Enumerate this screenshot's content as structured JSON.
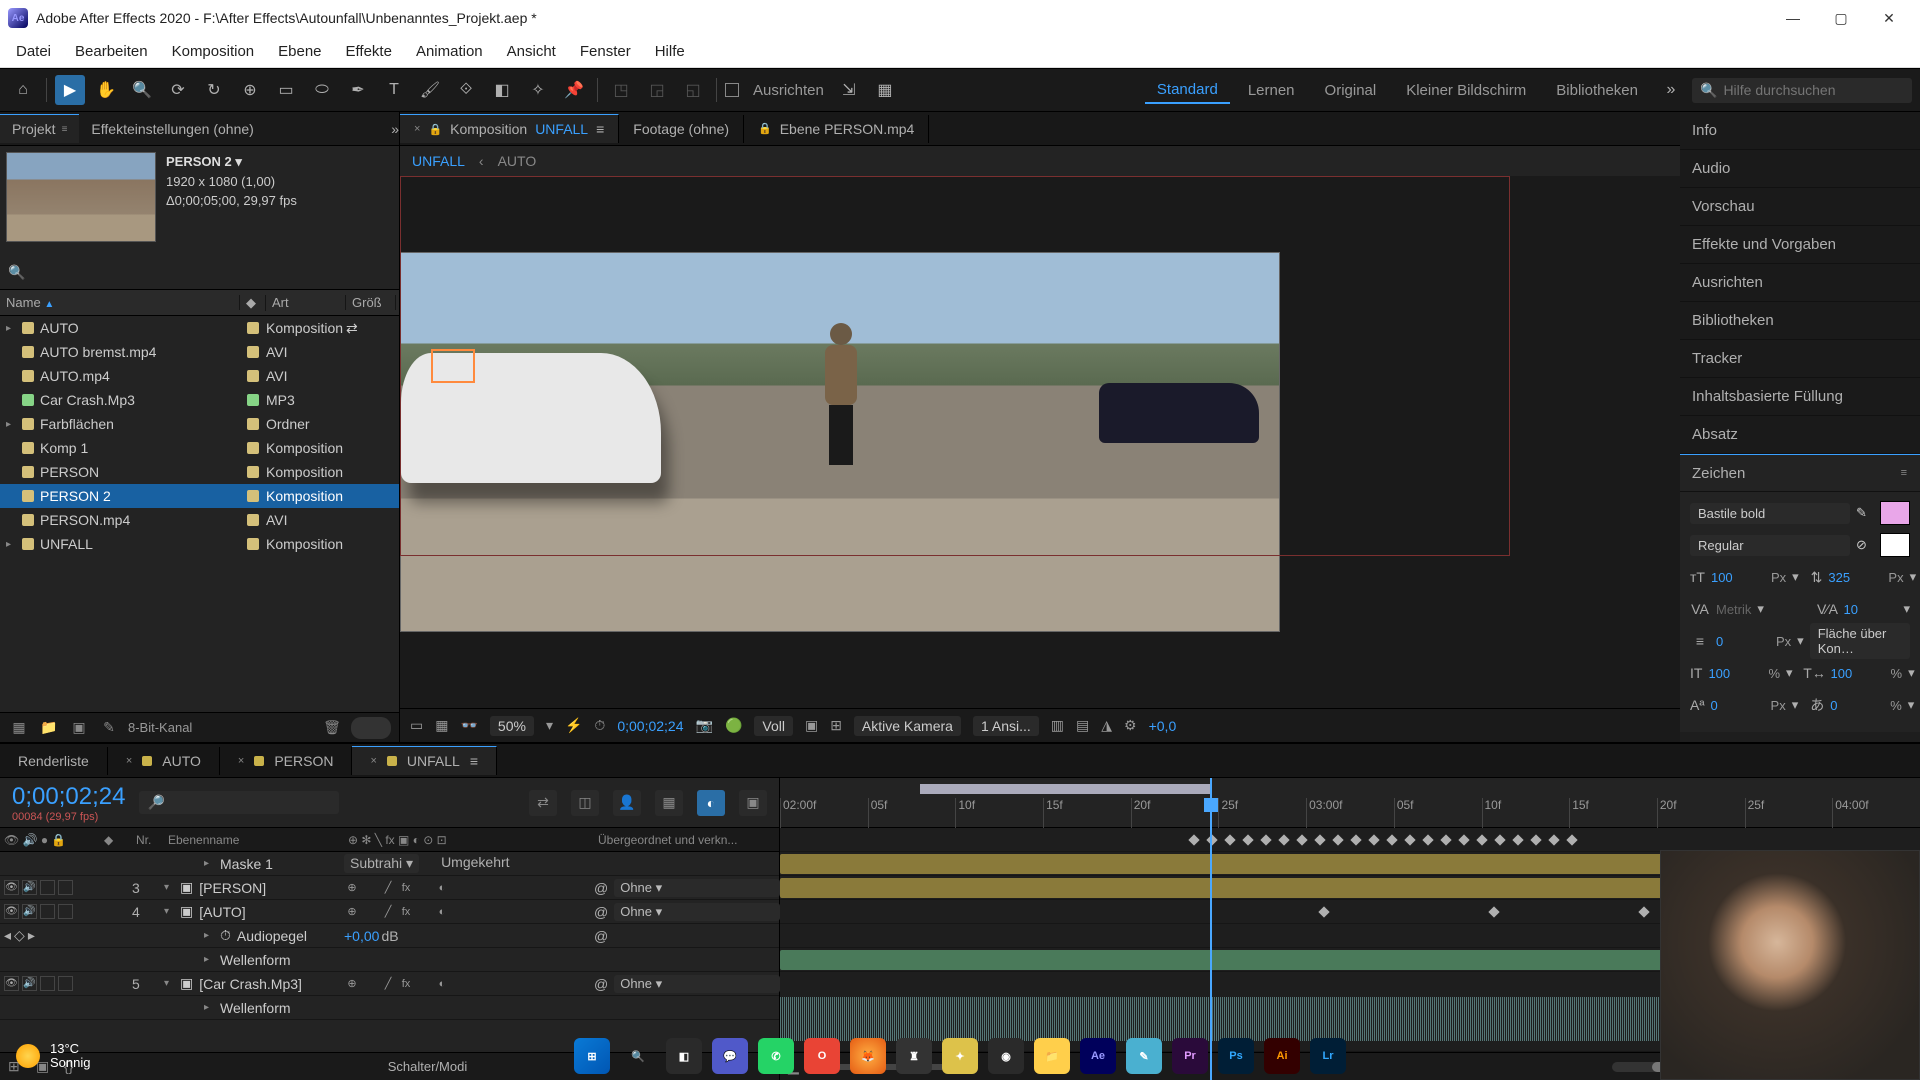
{
  "titlebar": {
    "app": "Adobe After Effects 2020",
    "path": "F:\\After Effects\\Autounfall\\Unbenanntes_Projekt.aep *"
  },
  "menu": {
    "items": [
      "Datei",
      "Bearbeiten",
      "Komposition",
      "Ebene",
      "Effekte",
      "Animation",
      "Ansicht",
      "Fenster",
      "Hilfe"
    ]
  },
  "toolbar": {
    "ausrichten_label": "Ausrichten",
    "workspaces": [
      "Standard",
      "Lernen",
      "Original",
      "Kleiner Bildschirm",
      "Bibliotheken"
    ],
    "active_ws": "Standard",
    "search_placeholder": "Hilfe durchsuchen"
  },
  "project_panel": {
    "tabs": {
      "project": "Projekt",
      "effect_controls": "Effekteinstellungen  (ohne)"
    },
    "selected_name": "PERSON 2 ▾",
    "selected_meta1": "1920 x 1080 (1,00)",
    "selected_meta2": "Δ0;00;05;00, 29,97 fps",
    "columns": {
      "name": "Name",
      "type": "Art",
      "size": "Größ"
    },
    "rows": [
      {
        "name": "AUTO",
        "type": "Komposition",
        "sw": "comp",
        "twirl": "▸",
        "has_special": true
      },
      {
        "name": "AUTO bremst.mp4",
        "type": "AVI",
        "sw": "avi"
      },
      {
        "name": "AUTO.mp4",
        "type": "AVI",
        "sw": "avi"
      },
      {
        "name": "Car Crash.Mp3",
        "type": "MP3",
        "sw": "mp3"
      },
      {
        "name": "Farbflächen",
        "type": "Ordner",
        "sw": "folder",
        "twirl": "▸"
      },
      {
        "name": "Komp 1",
        "type": "Komposition",
        "sw": "comp"
      },
      {
        "name": "PERSON",
        "type": "Komposition",
        "sw": "comp"
      },
      {
        "name": "PERSON 2",
        "type": "Komposition",
        "sw": "comp",
        "selected": true
      },
      {
        "name": "PERSON.mp4",
        "type": "AVI",
        "sw": "avi"
      },
      {
        "name": "UNFALL",
        "type": "Komposition",
        "sw": "comp",
        "twirl": "▸"
      }
    ],
    "footer_label": "8-Bit-Kanal"
  },
  "comp_panel": {
    "tabs": {
      "comp_label": "Komposition",
      "comp_active": "UNFALL",
      "footage": "Footage  (ohne)",
      "layer": "Ebene  PERSON.mp4"
    },
    "crumbs": [
      "UNFALL",
      "AUTO"
    ],
    "footer": {
      "zoom": "50%",
      "tc": "0;00;02;24",
      "res": "Voll",
      "camera": "Aktive Kamera",
      "views": "1 Ansi...",
      "expo": "+0,0"
    }
  },
  "right": {
    "panels": {
      "info": "Info",
      "audio": "Audio",
      "preview": "Vorschau",
      "effects": "Effekte und Vorgaben",
      "align": "Ausrichten",
      "libs": "Bibliotheken",
      "tracker": "Tracker",
      "contentfill": "Inhaltsbasierte Füllung",
      "para": "Absatz",
      "char": "Zeichen"
    },
    "char": {
      "font": "Bastile bold",
      "style": "Regular",
      "size": "100",
      "size_unit": "Px",
      "leading": "325",
      "leading_unit": "Px",
      "kerning": "Metrik",
      "tracking": "10",
      "stroke_w": "0",
      "stroke_w_unit": "Px",
      "stroke_pos": "Fläche über Kon…",
      "yscale": "100",
      "yscale_u": "%",
      "xscale": "100",
      "xscale_u": "%",
      "baseline": "0",
      "baseline_u": "Px",
      "tsume": "0",
      "tsume_u": "%"
    }
  },
  "timeline": {
    "tabs": {
      "render": "Renderliste",
      "auto": "AUTO",
      "person": "PERSON",
      "unfall": "UNFALL"
    },
    "timecode": "0;00;02;24",
    "subtime": "00084 (29,97 fps)",
    "header": {
      "toggles": "",
      "idx": "Nr.",
      "label": "",
      "name": "Ebenenname",
      "switches": "",
      "parent": "Übergeordnet und verkn..."
    },
    "sub_props": {
      "subtrahi": "Subtrahi",
      "umgekehrt": "Umgekehrt"
    },
    "rows": [
      {
        "kind": "sub",
        "name": "Maske 1",
        "indent": 1,
        "extras": "sub_umg"
      },
      {
        "num": "3",
        "color": "#c9b24a",
        "name": "[PERSON]",
        "parent": "Ohne"
      },
      {
        "num": "4",
        "color": "#c9b24a",
        "name": "[AUTO]",
        "parent": "Ohne"
      },
      {
        "kind": "sub",
        "name": "Audiopegel",
        "indent": 1,
        "value": "+0,00",
        "value_u": "dB",
        "has_kf_nav": true
      },
      {
        "kind": "sub",
        "name": "Wellenform",
        "indent": 1
      },
      {
        "num": "5",
        "color": "#7abf8f",
        "name": "[Car Crash.Mp3]",
        "parent": "Ohne"
      },
      {
        "kind": "sub",
        "name": "Wellenform",
        "indent": 1
      }
    ],
    "switches_modes_label": "Schalter/Modi",
    "ruler": [
      "02:00f",
      "05f",
      "10f",
      "15f",
      "20f",
      "25f",
      "03:00f",
      "05f",
      "10f",
      "15f",
      "20f",
      "25f",
      "04:00f"
    ]
  },
  "taskbar": {
    "temp": "13°C",
    "cond": "Sonnig"
  }
}
